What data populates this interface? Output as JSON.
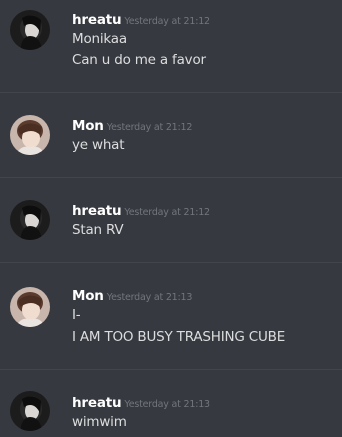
{
  "messages": [
    {
      "author": "hreatu",
      "timestamp": "Yesterday at 21:12",
      "avatar_icon": "girl-avatar-icon",
      "lines": [
        "Monikaa",
        "Can u do me a favor"
      ]
    },
    {
      "author": "Mon",
      "timestamp": "Yesterday at 21:12",
      "avatar_icon": "boy-avatar-icon",
      "lines": [
        "ye what"
      ]
    },
    {
      "author": "hreatu",
      "timestamp": "Yesterday at 21:12",
      "avatar_icon": "girl-avatar-icon",
      "lines": [
        "Stan RV"
      ]
    },
    {
      "author": "Mon",
      "timestamp": "Yesterday at 21:13",
      "avatar_icon": "boy-avatar-icon",
      "lines": [
        "I-",
        "I AM TOO BUSY TRASHING CUBE"
      ]
    },
    {
      "author": "hreatu",
      "timestamp": "Yesterday at 21:13",
      "avatar_icon": "girl-avatar-icon",
      "lines": [
        "wimwim"
      ]
    }
  ],
  "colors": {
    "background": "#36393f",
    "username": "#ffffff",
    "timestamp": "#72767d",
    "message_text": "#dcddde",
    "divider": "#42454a"
  }
}
